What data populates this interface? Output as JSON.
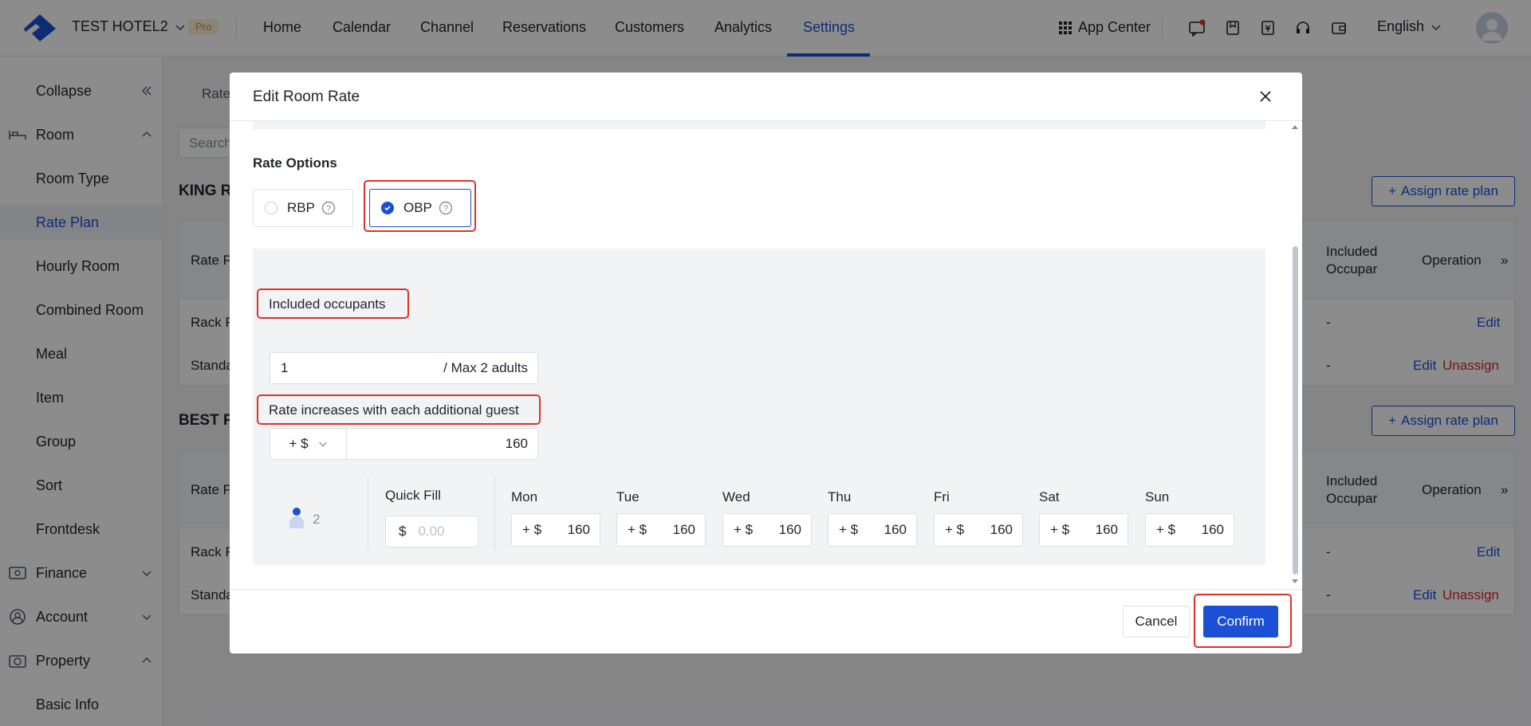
{
  "header": {
    "hotel_name": "TEST HOTEL2",
    "plan_badge": "Pro",
    "nav": [
      "Home",
      "Calendar",
      "Channel",
      "Reservations",
      "Customers",
      "Analytics",
      "Settings"
    ],
    "active_nav": "Settings",
    "app_center": "App Center",
    "language": "English"
  },
  "sidebar": {
    "collapse": "Collapse",
    "room": "Room",
    "room_items": [
      "Room Type",
      "Rate Plan",
      "Hourly Room",
      "Combined Room",
      "Meal",
      "Item",
      "Group",
      "Sort",
      "Frontdesk"
    ],
    "active_item": "Rate Plan",
    "finance": "Finance",
    "account": "Account",
    "property": "Property",
    "property_items": [
      "Basic Info"
    ]
  },
  "background": {
    "tab": "Rate",
    "search_placeholder": "Search",
    "section1_title": "KING R",
    "section2_title": "BEST R",
    "assign_label": "Assign rate plan",
    "col_rate_plan": "Rate P",
    "col_included": "Included Occupar",
    "col_operation": "Operation",
    "rows": [
      {
        "name": "Rack F",
        "included": "-",
        "edit": "Edit",
        "unassign": ""
      },
      {
        "name": "Standa",
        "included": "-",
        "edit": "Edit",
        "unassign": "Unassign"
      }
    ]
  },
  "modal": {
    "title": "Edit Room Rate",
    "rate_options_label": "Rate Options",
    "options": [
      {
        "label": "RBP",
        "selected": false
      },
      {
        "label": "OBP",
        "selected": true
      }
    ],
    "included_occupants_label": "Included occupants",
    "included_value": "1",
    "max_adults": "/ Max 2 adults",
    "increase_label": "Rate increases with each additional guest",
    "increase_op": "+ $",
    "increase_value": "160",
    "guest_count": "2",
    "quick_fill_label": "Quick Fill",
    "quick_fill_currency": "$",
    "quick_fill_placeholder": "0.00",
    "days": [
      {
        "day": "Mon",
        "prefix": "+ $",
        "value": "160"
      },
      {
        "day": "Tue",
        "prefix": "+ $",
        "value": "160"
      },
      {
        "day": "Wed",
        "prefix": "+ $",
        "value": "160"
      },
      {
        "day": "Thu",
        "prefix": "+ $",
        "value": "160"
      },
      {
        "day": "Fri",
        "prefix": "+ $",
        "value": "160"
      },
      {
        "day": "Sat",
        "prefix": "+ $",
        "value": "160"
      },
      {
        "day": "Sun",
        "prefix": "+ $",
        "value": "160"
      }
    ],
    "cancel": "Cancel",
    "confirm": "Confirm"
  },
  "colors": {
    "primary": "#1a4fd6",
    "highlight": "#e0312b",
    "danger": "#d9262c"
  }
}
